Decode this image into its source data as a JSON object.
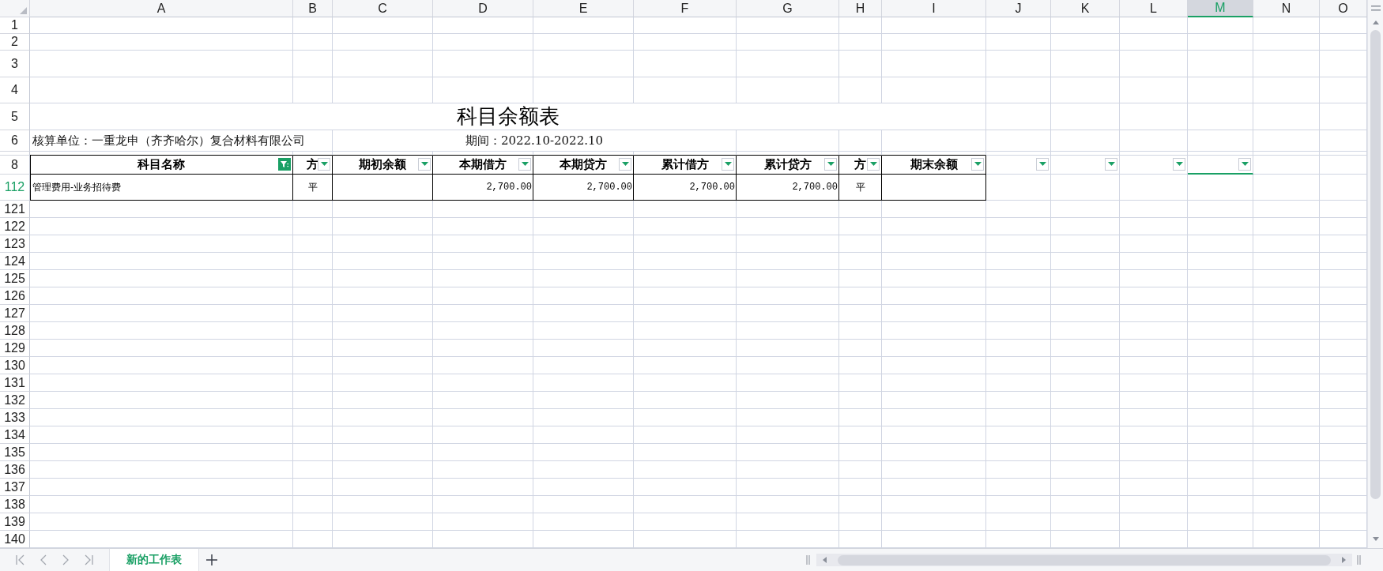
{
  "columns": [
    {
      "label": "A",
      "selected": false
    },
    {
      "label": "B",
      "selected": false
    },
    {
      "label": "C",
      "selected": false
    },
    {
      "label": "D",
      "selected": false
    },
    {
      "label": "E",
      "selected": false
    },
    {
      "label": "F",
      "selected": false
    },
    {
      "label": "G",
      "selected": false
    },
    {
      "label": "H",
      "selected": false
    },
    {
      "label": "I",
      "selected": false
    },
    {
      "label": "J",
      "selected": false
    },
    {
      "label": "K",
      "selected": false
    },
    {
      "label": "L",
      "selected": false
    },
    {
      "label": "M",
      "selected": true
    },
    {
      "label": "N",
      "selected": false
    },
    {
      "label": "O",
      "selected": false
    }
  ],
  "rows": [
    {
      "label": "1",
      "filtered": false
    },
    {
      "label": "2",
      "filtered": false
    },
    {
      "label": "3",
      "filtered": false
    },
    {
      "label": "4",
      "filtered": false
    },
    {
      "label": "5",
      "filtered": false
    },
    {
      "label": "6",
      "filtered": false
    },
    {
      "label": "8",
      "filtered": false
    },
    {
      "label": "112",
      "filtered": true
    },
    {
      "label": "121",
      "filtered": false
    },
    {
      "label": "122",
      "filtered": false
    },
    {
      "label": "123",
      "filtered": false
    },
    {
      "label": "124",
      "filtered": false
    },
    {
      "label": "125",
      "filtered": false
    },
    {
      "label": "126",
      "filtered": false
    },
    {
      "label": "127",
      "filtered": false
    },
    {
      "label": "128",
      "filtered": false
    },
    {
      "label": "129",
      "filtered": false
    },
    {
      "label": "130",
      "filtered": false
    },
    {
      "label": "131",
      "filtered": false
    },
    {
      "label": "132",
      "filtered": false
    },
    {
      "label": "133",
      "filtered": false
    },
    {
      "label": "134",
      "filtered": false
    },
    {
      "label": "135",
      "filtered": false
    },
    {
      "label": "136",
      "filtered": false
    },
    {
      "label": "137",
      "filtered": false
    },
    {
      "label": "138",
      "filtered": false
    },
    {
      "label": "139",
      "filtered": false
    },
    {
      "label": "140",
      "filtered": false
    }
  ],
  "title": "科目余额表",
  "unit": "核算单位：一重龙申（齐齐哈尔）复合材料有限公司",
  "period": "期间：2022.10-2022.10",
  "headers": [
    {
      "label": "科目名称",
      "filter_active": true
    },
    {
      "label": "方",
      "filter_active": false
    },
    {
      "label": "期初余额",
      "filter_active": false
    },
    {
      "label": "本期借方",
      "filter_active": false
    },
    {
      "label": "本期贷方",
      "filter_active": false
    },
    {
      "label": "累计借方",
      "filter_active": false
    },
    {
      "label": "累计贷方",
      "filter_active": false
    },
    {
      "label": "方",
      "filter_active": false
    },
    {
      "label": "期末余额",
      "filter_active": false
    },
    {
      "filter_active": false
    },
    {
      "filter_active": false
    },
    {
      "filter_active": false
    },
    {
      "filter_active": false
    }
  ],
  "data_row": {
    "account": "管理费用-业务招待费",
    "direction": "平",
    "debit": "2,700.00",
    "credit": "2,700.00",
    "cumulative_debit": "2,700.00",
    "cumulative_credit": "2,700.00",
    "end_direction": "平"
  },
  "sheet_tabs": [
    {
      "label": "新的工作表",
      "selected": true
    }
  ]
}
